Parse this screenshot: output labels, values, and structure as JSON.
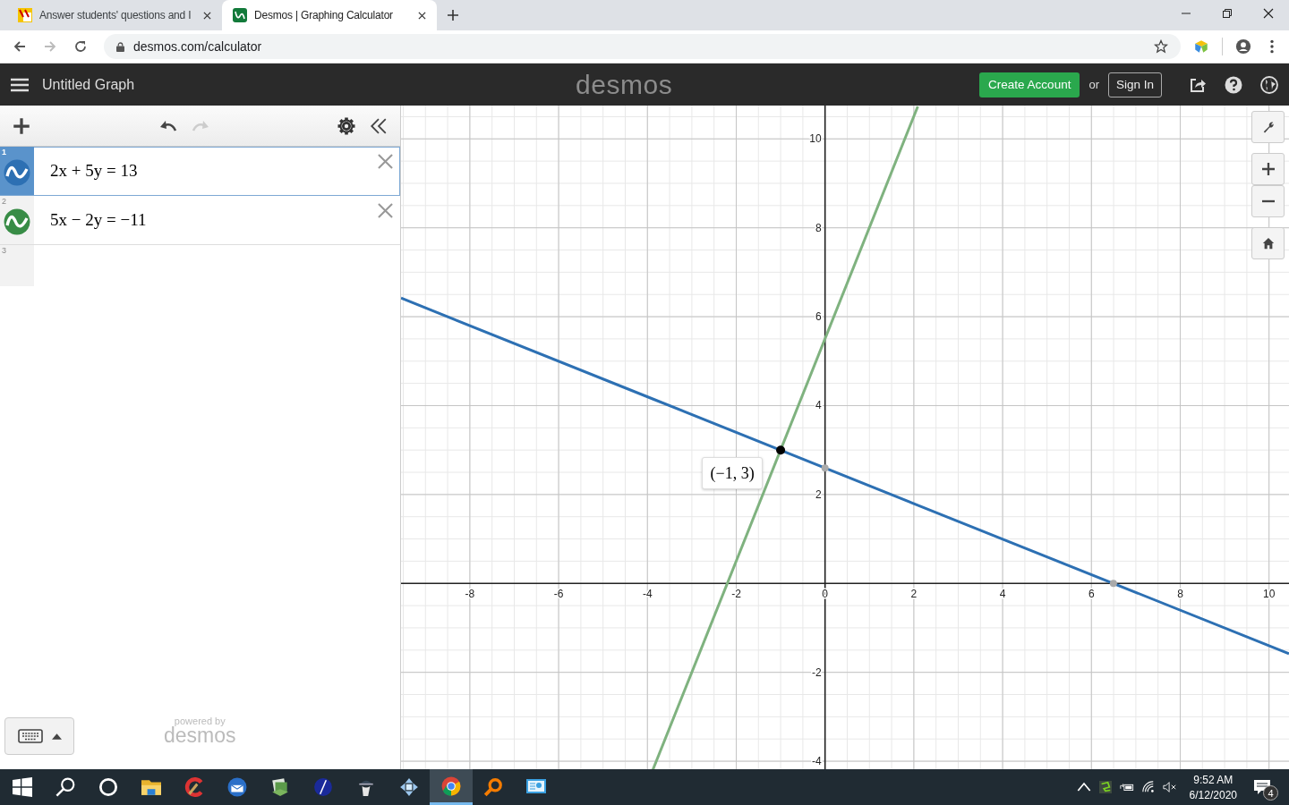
{
  "browser": {
    "tabs": [
      {
        "title": "Answer students' questions and I",
        "selected": false
      },
      {
        "title": "Desmos | Graphing Calculator",
        "selected": true
      }
    ],
    "url": "desmos.com/calculator"
  },
  "header": {
    "title": "Untitled Graph",
    "logo": "desmos",
    "create_account": "Create Account",
    "or": "or",
    "sign_in": "Sign In"
  },
  "expressions": [
    {
      "number": "1",
      "text": "2x + 5y = 13",
      "color": "#2d70b3",
      "selected": true
    },
    {
      "number": "2",
      "text": "5x − 2y = −11",
      "color": "#388c46",
      "selected": false
    },
    {
      "number": "3",
      "selected": false
    }
  ],
  "footer": {
    "powered_by": "powered by",
    "logo": "desmos"
  },
  "graph": {
    "chart_data": {
      "type": "line",
      "xlim": [
        -9.55,
        10.45
      ],
      "ylim": [
        -4.2,
        10.75
      ],
      "x": [
        -9.55,
        -3.88,
        2.09,
        10.45
      ],
      "series": [
        {
          "color": "#2d70b3",
          "values": [
            6.42,
            4.15,
            1.76,
            -1.58
          ]
        },
        {
          "color": "#7fb27f",
          "values": [
            null,
            -4.2,
            10.73,
            null
          ]
        }
      ],
      "xticks": [
        -8,
        -6,
        -4,
        -2,
        0,
        2,
        4,
        6,
        8,
        10
      ],
      "yticks": [
        -4,
        -2,
        2,
        4,
        6,
        8,
        10
      ],
      "grid": true,
      "annotations": [
        {
          "x": -1,
          "y": 3,
          "text": "(−1, 3)"
        }
      ]
    }
  },
  "taskbar": {
    "time": "9:52 AM",
    "date": "6/12/2020",
    "notifications": "4"
  }
}
